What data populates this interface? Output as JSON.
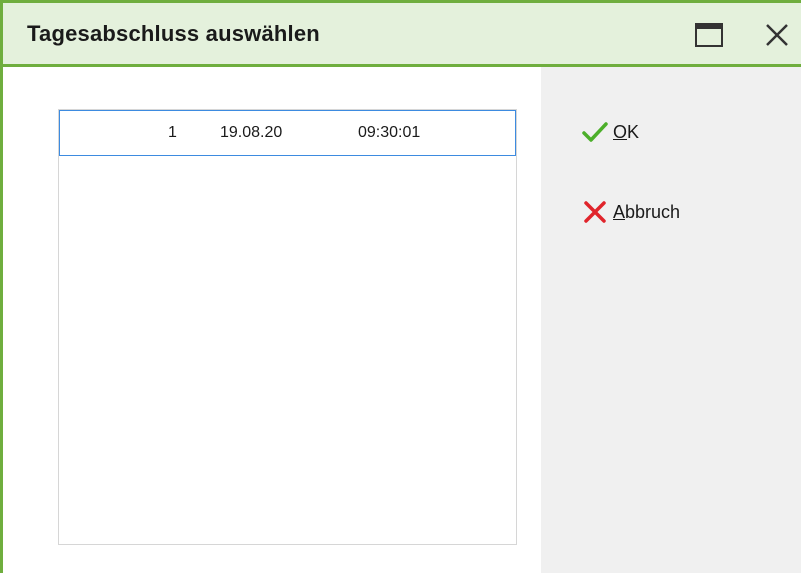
{
  "window": {
    "title": "Tagesabschluss auswählen",
    "accent_color": "#6fae3e",
    "titlebar_bg": "#e4f1dc",
    "controls": [
      {
        "icon": "maximize-icon"
      },
      {
        "icon": "close-icon"
      }
    ]
  },
  "list": {
    "selected_index": 0,
    "rows": [
      {
        "nr": "1",
        "date": "19.08.20",
        "time": "09:30:01"
      }
    ],
    "selection_border_color": "#3d8be0"
  },
  "actions": {
    "ok": {
      "mnemonic": "O",
      "rest": "K",
      "icon": "checkmark-icon",
      "icon_color": "#4caf2a"
    },
    "cancel": {
      "mnemonic": "A",
      "rest": "bbruch",
      "icon": "cross-icon",
      "icon_color": "#e0242b"
    }
  }
}
